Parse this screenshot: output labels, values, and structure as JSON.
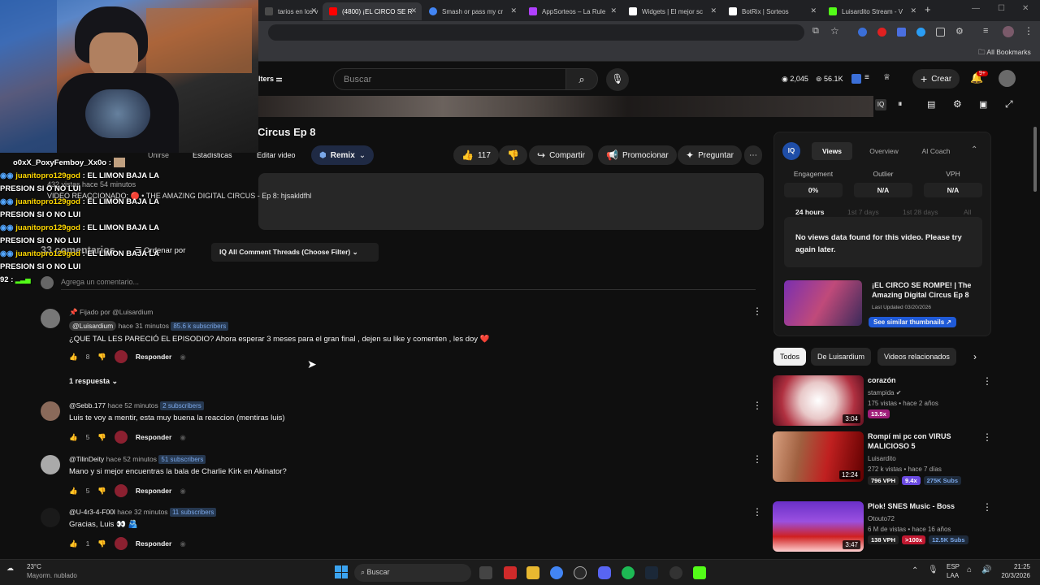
{
  "browser": {
    "tabs": [
      {
        "label": "tarios en los v",
        "color": "#4a4a4a"
      },
      {
        "label": "(4800) ¡EL CIRCO SE R",
        "color": "#ff0000"
      },
      {
        "label": "Smash or pass my cr",
        "color": "#4285f4"
      },
      {
        "label": "AppSorteos – La Rule",
        "color": "#b040ff"
      },
      {
        "label": "Widgets | El mejor sc",
        "color": "#ffffff"
      },
      {
        "label": "BotRix | Sorteos",
        "color": "#ffffff"
      },
      {
        "label": "Luisardito Stream - V",
        "color": "#53fc18"
      }
    ],
    "new_tab": "+",
    "bookmarks_label": "All Bookmarks"
  },
  "header": {
    "filters_label": "lters",
    "search_placeholder": "Buscar",
    "views_count": "2,045",
    "subs_count": "56.1K",
    "create_label": "Crear",
    "notif_badge": "9+"
  },
  "video": {
    "title": "Circus Ep 8",
    "tabs": [
      "Unirse",
      "Estadísticas",
      "Editar video"
    ],
    "remix_label": "Remix",
    "like_count": "117",
    "share_label": "Compartir",
    "promote_label": "Promocionar",
    "ask_label": "Preguntar",
    "desc_meta": "432 vistas  hace 54 minutos",
    "desc_line": "VIDEO REACCIONADO: 🔴 • THE AMAZING DIGITAL CIRCUS - Ep 8: hjsakldfhl"
  },
  "chat": {
    "top_user": "o0xX_PoxyFemboy_Xx0o :",
    "messages": [
      {
        "user": "juanitopro129god",
        "text": ": EL LIMON BAJA LA",
        "text2": "PRESION SI O NO LUI"
      },
      {
        "user": "juanitopro129god",
        "text": ": EL LIMON BAJA LA",
        "text2": "PRESION SI O NO LUI"
      },
      {
        "user": "juanitopro129god",
        "text": ": EL LIMON BAJA LA",
        "text2": "PRESION SI O NO LUI"
      },
      {
        "user": "juanitopro129god",
        "text": ": EL LIMON BAJA LA",
        "text2": "PRESION SI O NO LUI"
      }
    ],
    "bottom_prefix": "92 :"
  },
  "comments_section": {
    "count_label": "33 comentarios",
    "sort_label": "Ordenar por",
    "filter_label": "All Comment Threads (Choose Filter)",
    "add_placeholder": "Agrega un comentario...",
    "pinned_label": "Fijado por @Luisardium",
    "replies_label": "1 respuesta",
    "reply_label": "Responder",
    "comments": [
      {
        "author": "@Luisardium",
        "time": "hace 31 minutos",
        "subs": "85.6 k subscribers",
        "text": "¿QUE TAL LES PARECIÓ EL EPISODIO? Ahora esperar 3 meses para el gran final , dejen su like y comenten , les doy ❤️",
        "likes": "8"
      },
      {
        "author": "@Sebb.177",
        "time": "hace 52 minutos",
        "subs": "2 subscribers",
        "text": "Luis te voy a mentir, esta muy buena la reaccion (mentiras luis)",
        "likes": "5"
      },
      {
        "author": "@TilinDeity",
        "time": "hace 52 minutos",
        "subs": "51 subscribers",
        "text": "Mano y si mejor encuentras la bala de Charlie Kirk en Akinator?",
        "likes": "5"
      },
      {
        "author": "@U-4r3-4-F00l",
        "time": "hace 32 minutos",
        "subs": "11 subscribers",
        "text": "Gracias, Luis 👀 🫂",
        "likes": "1"
      }
    ]
  },
  "vidiq": {
    "tabs": [
      "Views",
      "Overview",
      "AI Coach"
    ],
    "stats": [
      {
        "label": "Engagement",
        "value": "0%"
      },
      {
        "label": "Outlier",
        "value": "N/A"
      },
      {
        "label": "VPH",
        "value": "N/A"
      }
    ],
    "ranges": [
      "24 hours",
      "1st 7 days",
      "1st 28 days",
      "All"
    ],
    "no_data": "No views data found for this video. Please try again later.",
    "promo_title": "¡EL CIRCO SE ROMPE! | The Amazing Digital Circus Ep 8",
    "promo_updated": "Last Updated 03/20/2026",
    "promo_button": "See similar thumbnails ↗"
  },
  "recs": {
    "chips": [
      "Todos",
      "De Luisardium",
      "Videos relacionados"
    ],
    "items": [
      {
        "title": "corazón",
        "channel": "stampida",
        "meta": "175 vistas • hace 2 años",
        "duration": "3:04",
        "b1": "13.5x",
        "b2": "",
        "b3": ""
      },
      {
        "title": "Rompí mi pc con VIRUS MALICIOSO 5",
        "channel": "Luisardito",
        "meta": "272 k vistas • hace 7 días",
        "duration": "12:24",
        "b1": "796 VPH",
        "b2": "9.4x",
        "b3": "275K Subs"
      },
      {
        "title": "Plok! SNES Music - Boss",
        "channel": "Otouto72",
        "meta": "6 M de vistas • hace 16 años",
        "duration": "3:47",
        "b1": "138 VPH",
        "b2": ">100x",
        "b3": "12.5K Subs"
      }
    ]
  },
  "taskbar": {
    "temp": "23°C",
    "weather": "Mayorm. nublado",
    "search": "Buscar",
    "lang1": "ESP",
    "lang2": "LAA",
    "time": "21:25",
    "date": "20/3/2026"
  }
}
